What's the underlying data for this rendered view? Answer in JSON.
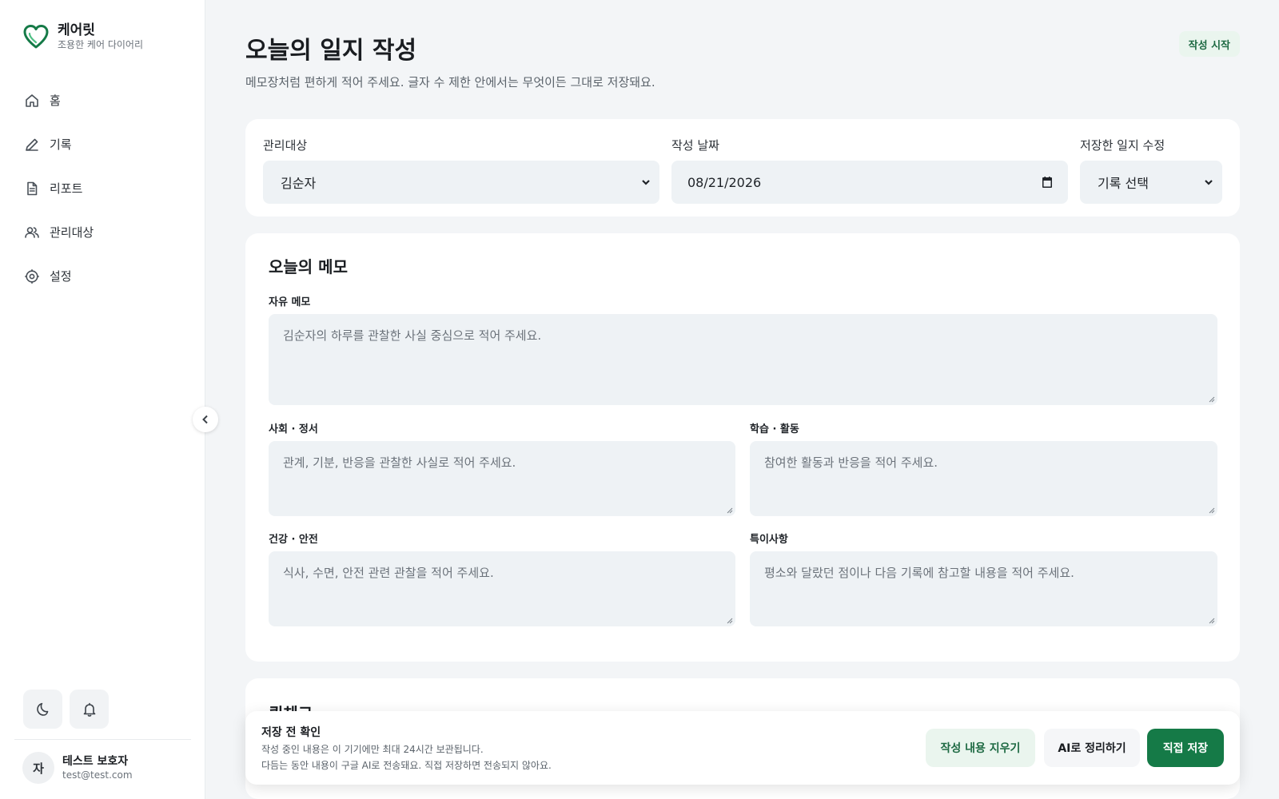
{
  "brand": {
    "name": "케어릿",
    "tagline": "조용한 케어 다이어리"
  },
  "nav": [
    {
      "label": "홈",
      "icon": "home-icon"
    },
    {
      "label": "기록",
      "icon": "pencil-icon"
    },
    {
      "label": "리포트",
      "icon": "document-icon"
    },
    {
      "label": "관리대상",
      "icon": "users-icon"
    },
    {
      "label": "설정",
      "icon": "gear-icon"
    }
  ],
  "user": {
    "initial": "자",
    "name": "테스트 보호자",
    "email": "test@test.com"
  },
  "page": {
    "title": "오늘의 일지 작성",
    "subtitle": "메모장처럼 편하게 적어 주세요. 글자 수 제한 안에서는 무엇이든 그대로 저장돼요.",
    "status": "작성 시작"
  },
  "fields": {
    "subject_label": "관리대상",
    "subject_value": "김순자",
    "date_label": "작성 날짜",
    "date_value": "08/21/2026",
    "edit_label": "저장한 일지 수정",
    "edit_value": "기록 선택"
  },
  "memo": {
    "title": "오늘의 메모",
    "free_label": "자유 메모",
    "free_placeholder": "김순자의 하루를 관찰한 사실 중심으로 적어 주세요.",
    "social_label": "사회 · 정서",
    "social_placeholder": "관계, 기분, 반응을 관찰한 사실로 적어 주세요.",
    "learning_label": "학습 · 활동",
    "learning_placeholder": "참여한 활동과 반응을 적어 주세요.",
    "health_label": "건강 · 안전",
    "health_placeholder": "식사, 수면, 안전 관련 관찰을 적어 주세요.",
    "notes_label": "특이사항",
    "notes_placeholder": "평소와 달랐던 점이나 다음 기록에 참고할 내용을 적어 주세요."
  },
  "quick": {
    "title": "퀵체크"
  },
  "banner": {
    "title": "저장 전 확인",
    "line1": "작성 중인 내용은 이 기기에만 최대 24시간 보관됩니다.",
    "line2": "다듬는 동안 내용이 구글 AI로 전송돼요. 직접 저장하면 전송되지 않아요.",
    "clear_label": "작성 내용 지우기",
    "ai_label": "AI로 정리하기",
    "save_label": "직접 저장"
  },
  "colors": {
    "accent": "#157a47",
    "accent_light": "#eaf5ee",
    "field_bg": "#eef2f5"
  }
}
